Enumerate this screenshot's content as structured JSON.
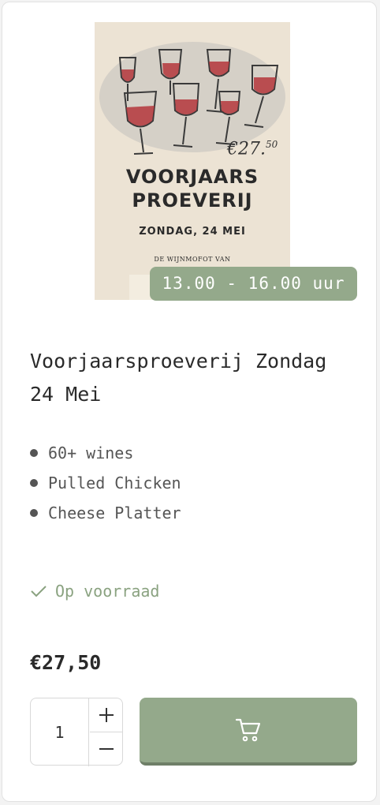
{
  "poster": {
    "price_main": "€27.",
    "price_cents": "50",
    "title_line1": "VOORJAARS",
    "title_line2": "PROEVERIJ",
    "date_line": "ZONDAG, 24 MEI",
    "footer_line": "DE WIJNMOFOT VAN"
  },
  "time_badge": "13.00 - 16.00 uur",
  "product_title": "Voorjaarsproeverij Zondag 24 Mei",
  "features": [
    "60+ wines",
    "Pulled Chicken",
    "Cheese Platter"
  ],
  "stock_status": "Op voorraad",
  "price": "€27,50",
  "quantity": "1",
  "icons": {
    "stock": "check-icon",
    "plus": "plus-icon",
    "minus": "minus-icon",
    "cart": "cart-icon"
  },
  "colors": {
    "accent_green": "#94a98b",
    "stock_green": "#8aa280",
    "wine_red": "#b5373c"
  }
}
